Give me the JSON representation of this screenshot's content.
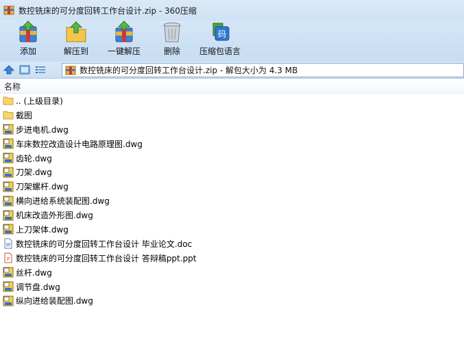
{
  "window": {
    "title": "数控铣床的可分度回转工作台设计.zip - 360压缩"
  },
  "toolbar": {
    "items": [
      {
        "label": "添加",
        "icon": "add-archive-icon"
      },
      {
        "label": "解压到",
        "icon": "extract-to-icon"
      },
      {
        "label": "一键解压",
        "icon": "one-click-extract-icon"
      },
      {
        "label": "删除",
        "icon": "trash-icon"
      },
      {
        "label": "压缩包语言",
        "icon": "archive-language-icon"
      }
    ]
  },
  "addressbar": {
    "path": "数控铣床的可分度回转工作台设计.zip - 解包大小为 4.3 MB"
  },
  "list": {
    "column_name": "名称",
    "rows": [
      {
        "name": ".. (上级目录)",
        "type": "folder"
      },
      {
        "name": "截图",
        "type": "folder"
      },
      {
        "name": "步进电机.dwg",
        "type": "dwg"
      },
      {
        "name": "车床数控改造设计电路原理图.dwg",
        "type": "dwg"
      },
      {
        "name": "齿轮.dwg",
        "type": "dwg"
      },
      {
        "name": "刀架.dwg",
        "type": "dwg"
      },
      {
        "name": "刀架螺杆.dwg",
        "type": "dwg"
      },
      {
        "name": "横向进给系统装配图.dwg",
        "type": "dwg"
      },
      {
        "name": "机床改造外形图.dwg",
        "type": "dwg"
      },
      {
        "name": "上刀架体.dwg",
        "type": "dwg"
      },
      {
        "name": "数控铣床的可分度回转工作台设计 毕业论文.doc",
        "type": "doc"
      },
      {
        "name": "数控铣床的可分度回转工作台设计 答辩稿ppt.ppt",
        "type": "ppt"
      },
      {
        "name": "丝杆.dwg",
        "type": "dwg"
      },
      {
        "name": "调节盘.dwg",
        "type": "dwg"
      },
      {
        "name": "纵向进给装配图.dwg",
        "type": "dwg"
      }
    ]
  }
}
